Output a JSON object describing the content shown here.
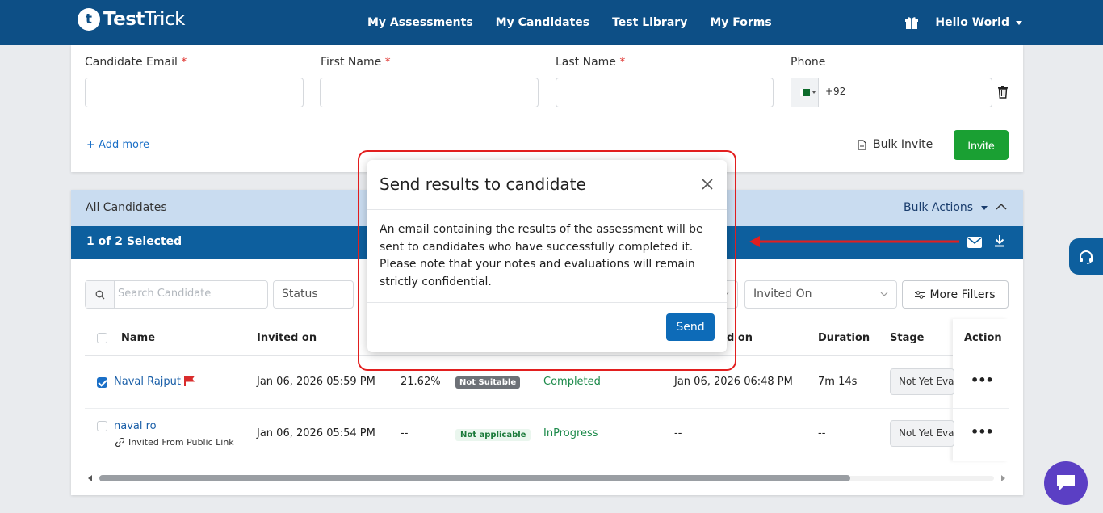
{
  "brand": {
    "mark": "t",
    "name_bold": "Test",
    "name_rest": "Trick"
  },
  "nav": [
    "My Assessments",
    "My Candidates",
    "Test Library",
    "My Forms"
  ],
  "user": {
    "greeting": "Hello World"
  },
  "invite_form": {
    "email_label": "Candidate Email",
    "first_name_label": "First Name",
    "last_name_label": "Last Name",
    "phone_label": "Phone",
    "required_mark": "*",
    "phone_code": "+92",
    "add_more": "+ Add more",
    "bulk_invite": "Bulk Invite",
    "invite": "Invite"
  },
  "candidates": {
    "title": "All Candidates",
    "bulk_actions": "Bulk Actions",
    "selected": "1 of 2 Selected",
    "search_placeholder": "Search Candidate",
    "filter_status": "Status",
    "filter_invited_on": "Invited On",
    "more_filters": "More Filters",
    "columns": {
      "name": "Name",
      "invited_on": "Invited on",
      "completed_on_partial": "d on",
      "duration": "Duration",
      "stage": "Stage",
      "action": "Action"
    },
    "rows": [
      {
        "name": "Naval Rajput",
        "invited_on": "Jan 06, 2026 05:59 PM",
        "score": "21.62%",
        "suitability": "Not Suitable",
        "status": "Completed",
        "completed_on": "Jan 06, 2026 06:48 PM",
        "duration": "7m 14s",
        "stage": "Not Yet Evaluated",
        "action": "•••"
      },
      {
        "name": "naval ro",
        "sub": "Invited From Public Link",
        "invited_on": "Jan 06, 2026 05:54 PM",
        "score": "--",
        "suitability": "Not applicable",
        "status": "InProgress",
        "completed_on": "--",
        "duration": "--",
        "stage": "Not Yet Evaluated",
        "action": "•••"
      }
    ]
  },
  "modal": {
    "title": "Send results to candidate",
    "body": "An email containing the results of the assessment will be sent to candidates who have successfully completed it. Please note that your notes and evaluations will remain strictly confidential.",
    "send": "Send"
  },
  "colors": {
    "nav_bg": "#0d4f86",
    "selected_bar": "#0d5f9e",
    "invite_green": "#1aa033",
    "highlight_red": "#e21f1f",
    "chat_purple": "#5b3fc4"
  }
}
